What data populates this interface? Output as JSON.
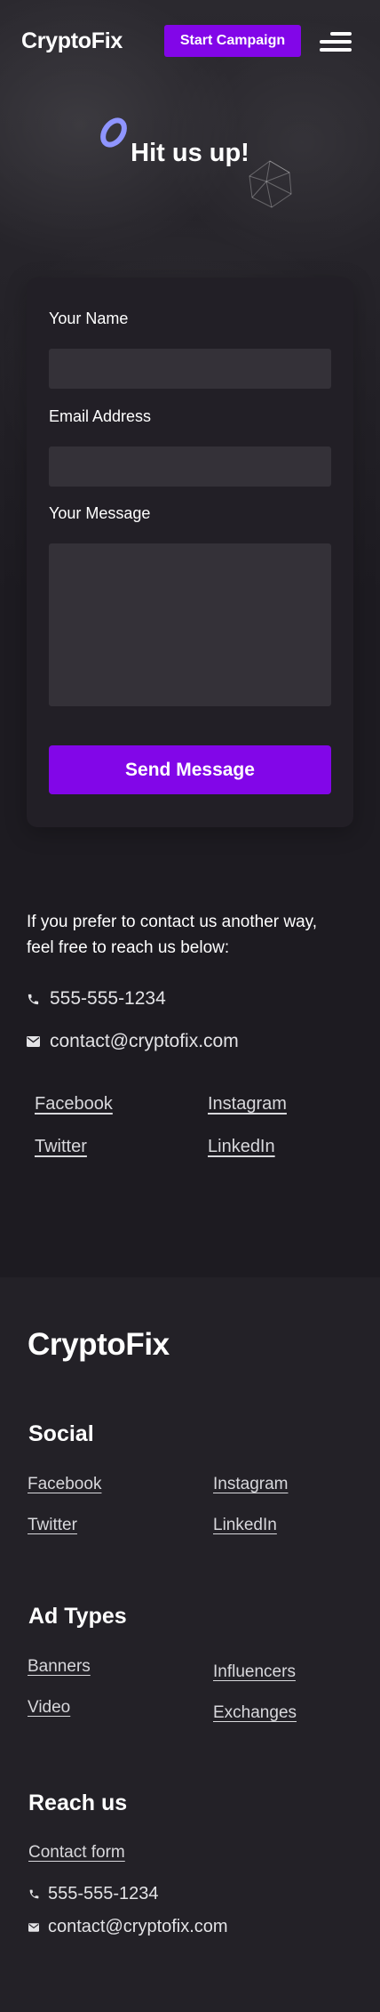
{
  "header": {
    "logo": "CryptoFix",
    "cta_label": "Start Campaign",
    "menu_icon": "hamburger-menu-icon"
  },
  "hero": {
    "title": "Hit us up!",
    "decor_icons": [
      "ring-icon",
      "polyhedron-icon"
    ]
  },
  "form": {
    "name_label": "Your Name",
    "name_value": "",
    "email_label": "Email Address",
    "email_value": "",
    "message_label": "Your Message",
    "message_value": "",
    "submit_label": "Send Message"
  },
  "contact": {
    "intro": "If you prefer to contact us another way, feel free to reach us below:",
    "phone": "555-555-1234",
    "email": "contact@cryptofix.com",
    "social": [
      "Facebook",
      "Instagram",
      "Twitter",
      "LinkedIn"
    ]
  },
  "footer": {
    "logo": "CryptoFix",
    "social": {
      "heading": "Social",
      "links": [
        "Facebook",
        "Instagram",
        "Twitter",
        "LinkedIn"
      ]
    },
    "ad_types": {
      "heading": "Ad Types",
      "links": [
        "Banners",
        "Influencers",
        "Video",
        "Exchanges"
      ]
    },
    "reach": {
      "heading": "Reach us",
      "form_link": "Contact form",
      "phone": "555-555-1234",
      "email": "contact@cryptofix.com"
    }
  },
  "colors": {
    "accent": "#8206e8",
    "background": "#1d1b21",
    "card": "#221f26",
    "input": "#343138",
    "ring": "#8f95ff"
  }
}
